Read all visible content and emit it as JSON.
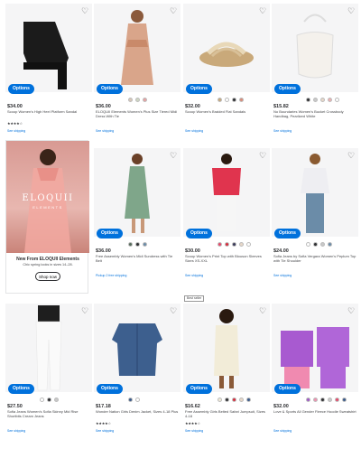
{
  "options_label": "Options",
  "heart_icon": "heart-icon",
  "products": [
    {
      "price": "$34.00",
      "title": "Scoop Women's High Heel Platform Sandal",
      "stars": "★★★★☆",
      "shipping": "See shipping",
      "swatches": []
    },
    {
      "price": "$36.00",
      "title": "ELOQUII Elements Women's Plus Size Tiered Midi Dress With Tie",
      "stars": "",
      "shipping": "See shipping",
      "swatches": [
        "#d9c7b8",
        "#cfd7c2",
        "#e8a0a0"
      ]
    },
    {
      "price": "$32.00",
      "title": "Scoop Women's Braided Flat Sandals",
      "stars": "",
      "shipping": "See shipping",
      "swatches": [
        "#c9a97a",
        "#ffffff",
        "#2e2f32",
        "#d98c7a"
      ]
    },
    {
      "price": "$15.82",
      "title": "No Boundaries Women's Bucket Crossbody Handbag, Pearlized White",
      "stars": "",
      "shipping": "See shipping",
      "swatches": [
        "#2e2f32",
        "#c9c9c9",
        "#e8d8c8",
        "#f0b0b0",
        "#ffffff"
      ]
    },
    {
      "price": "$36.00",
      "title": "Free Assembly Women's Midi Sundress with Tie Belt",
      "stars": "",
      "shipping": "Pickup  2 free shipping",
      "swatches": [
        "#556b5a",
        "#2e2f32",
        "#6b8ca8"
      ]
    },
    {
      "price": "$30.00",
      "title": "Scoop Women's Print Top with Blouson Sleeves Sizes XS-XXL",
      "stars": "",
      "shipping": "See shipping",
      "swatches": [
        "#e8486a",
        "#d82c3c",
        "#3a3a5a",
        "#e8d8c8",
        "#ffffff"
      ]
    },
    {
      "price": "$24.00",
      "title": "Sofia Jeans by Sofia Vergara Women's Peplum Top with Tie Shoulder",
      "stars": "",
      "shipping": "See shipping",
      "swatches": [
        "#ffffff",
        "#2e2f32",
        "#c9c9c9",
        "#6b8ca8"
      ]
    },
    {
      "price": "$27.50",
      "title": "Sofia Jeans Women's Sofia Skinny Mid Rise Shortbits Cream Jeans",
      "stars": "",
      "shipping": "See shipping",
      "swatches": [
        "#ffffff",
        "#2e2f32",
        "#c9c9c9"
      ]
    },
    {
      "price": "$17.18",
      "title": "Wonder Nation Girls Denim Jacket, Sizes 4-18 Plus",
      "stars": "★★★★☆",
      "shipping": "See shipping",
      "swatches": [
        "#3a5a8a",
        "#ffffff"
      ]
    },
    {
      "price": "$16.62",
      "title": "Free Assembly Girls Belted Safari Jumpsuit, Sizes 4-18",
      "stars": "★★★★☆",
      "shipping": "See shipping",
      "swatches": [
        "#f0ead8",
        "#2e2f32",
        "#d82c3c",
        "#e8d8c8",
        "#3a5a8a"
      ]
    },
    {
      "price": "$32.00",
      "title": "Love & Sports All Gender Fleece Hoodie Sweatshirt",
      "stars": "",
      "shipping": "See shipping",
      "swatches": [
        "#a058c8",
        "#f090b0",
        "#2e2f32",
        "#c9c9c9",
        "#e8486a",
        "#3a5a8a"
      ]
    }
  ],
  "promo": {
    "logo": "ELOQUII",
    "logo_sub": "ELEMENTS",
    "title": "New From ELOQUII Elements",
    "desc": "Chic spring looks in sizes 14–28.",
    "button": "Shop now"
  },
  "badge": "Best seller"
}
